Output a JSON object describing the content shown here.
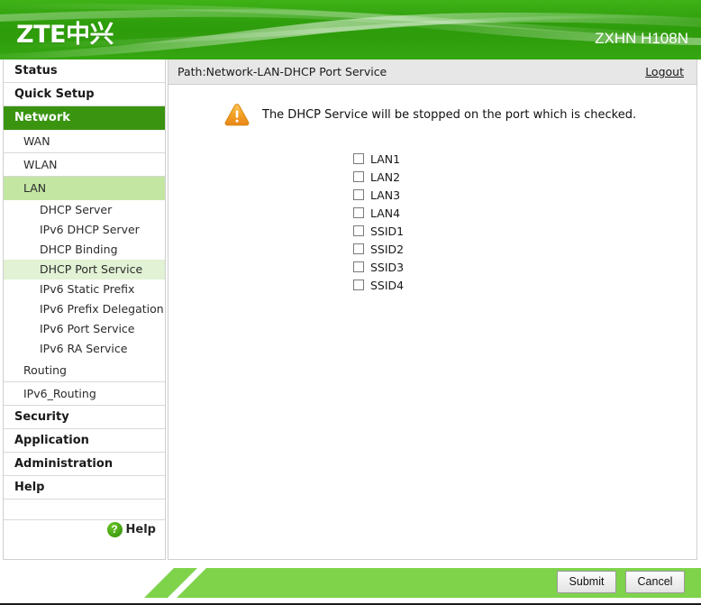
{
  "header": {
    "logo_text": "ZTE中兴",
    "model": "ZXHN H108N",
    "brand_green": "#2e9c0b",
    "accent_green": "#7ed34b"
  },
  "sidebar": {
    "items": [
      {
        "label": "Status",
        "level": 0,
        "active": false
      },
      {
        "label": "Quick Setup",
        "level": 0,
        "active": false
      },
      {
        "label": "Network",
        "level": 0,
        "active": true
      },
      {
        "label": "WAN",
        "level": 1,
        "active": false
      },
      {
        "label": "WLAN",
        "level": 1,
        "active": false
      },
      {
        "label": "LAN",
        "level": 1,
        "active": true
      },
      {
        "label": "DHCP Server",
        "level": 2,
        "active": false
      },
      {
        "label": "IPv6 DHCP Server",
        "level": 2,
        "active": false
      },
      {
        "label": "DHCP Binding",
        "level": 2,
        "active": false
      },
      {
        "label": "DHCP Port Service",
        "level": 2,
        "active": true
      },
      {
        "label": "IPv6 Static Prefix",
        "level": 2,
        "active": false
      },
      {
        "label": "IPv6 Prefix Delegation",
        "level": 2,
        "active": false
      },
      {
        "label": "IPv6 Port Service",
        "level": 2,
        "active": false
      },
      {
        "label": "IPv6 RA Service",
        "level": 2,
        "active": false
      },
      {
        "label": "Routing",
        "level": 1,
        "active": false
      },
      {
        "label": "IPv6_Routing",
        "level": 1,
        "active": false
      },
      {
        "label": "Security",
        "level": 0,
        "active": false
      },
      {
        "label": "Application",
        "level": 0,
        "active": false
      },
      {
        "label": "Administration",
        "level": 0,
        "active": false
      },
      {
        "label": "Help",
        "level": 0,
        "active": false
      }
    ],
    "help_button": {
      "icon": "question-mark-circle-icon",
      "glyph": "?",
      "label": "Help"
    }
  },
  "content": {
    "path": "Path:Network-LAN-DHCP Port Service",
    "logout_label": "Logout",
    "notice": {
      "icon": "warning-triangle-icon",
      "text": "The DHCP Service will be stopped on the port which is checked.",
      "icon_color": "#f0a125"
    },
    "ports": [
      {
        "label": "LAN1",
        "checked": false
      },
      {
        "label": "LAN2",
        "checked": false
      },
      {
        "label": "LAN3",
        "checked": false
      },
      {
        "label": "LAN4",
        "checked": false
      },
      {
        "label": "SSID1",
        "checked": false
      },
      {
        "label": "SSID2",
        "checked": false
      },
      {
        "label": "SSID3",
        "checked": false
      },
      {
        "label": "SSID4",
        "checked": false
      }
    ]
  },
  "footer": {
    "submit_label": "Submit",
    "cancel_label": "Cancel"
  }
}
